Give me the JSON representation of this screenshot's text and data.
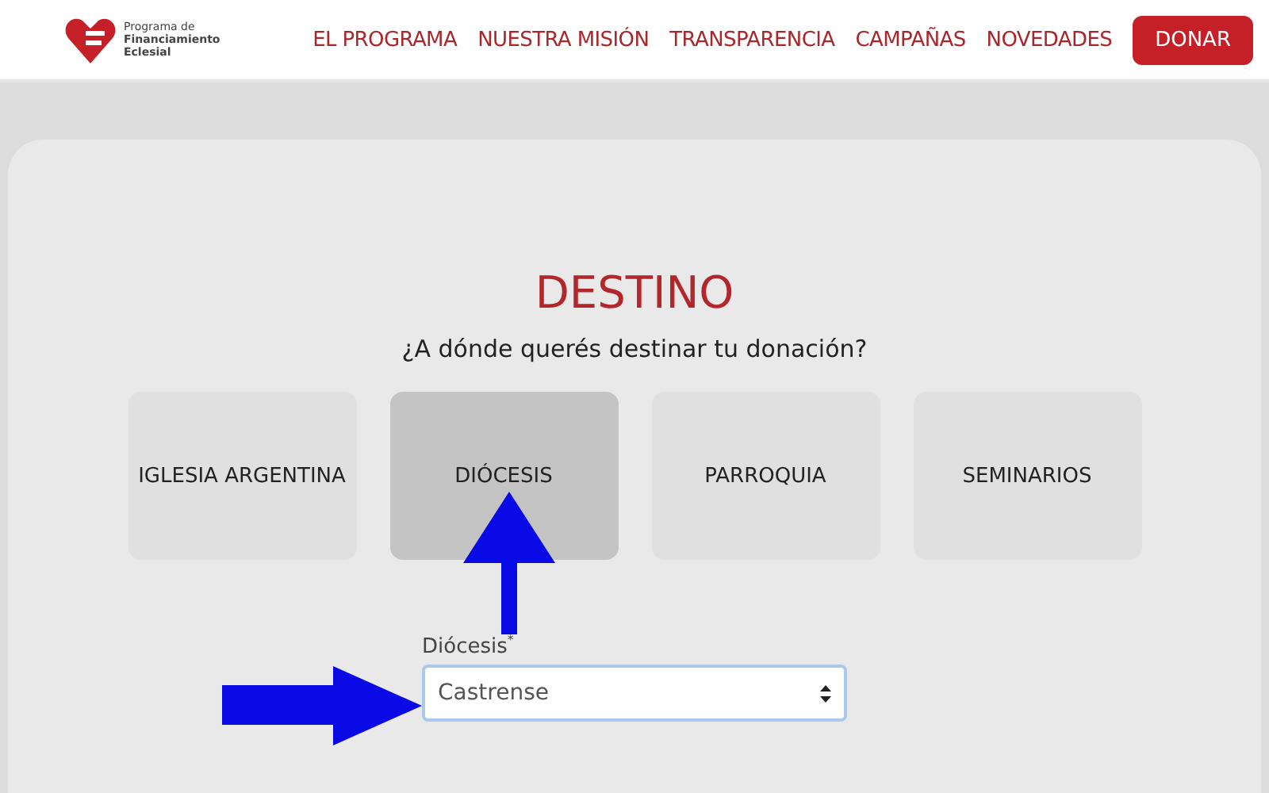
{
  "header": {
    "logo_text": [
      "Programa de",
      "Financiamiento",
      "Eclesial"
    ],
    "nav": [
      {
        "label": "EL PROGRAMA"
      },
      {
        "label": "NUESTRA MISIÓN"
      },
      {
        "label": "TRANSPARENCIA"
      },
      {
        "label": "CAMPAÑAS"
      },
      {
        "label": "NOVEDADES"
      }
    ],
    "cta": "DONAR"
  },
  "section": {
    "title": "DESTINO",
    "question": "¿A dónde querés destinar tu donación?",
    "options": [
      {
        "label": "IGLESIA ARGENTINA",
        "selected": false
      },
      {
        "label": "DIÓCESIS",
        "selected": true
      },
      {
        "label": "PARROQUIA",
        "selected": false
      },
      {
        "label": "SEMINARIOS",
        "selected": false
      }
    ],
    "field": {
      "label": "Diócesis",
      "required_mark": "*",
      "value": "Castrense"
    }
  }
}
